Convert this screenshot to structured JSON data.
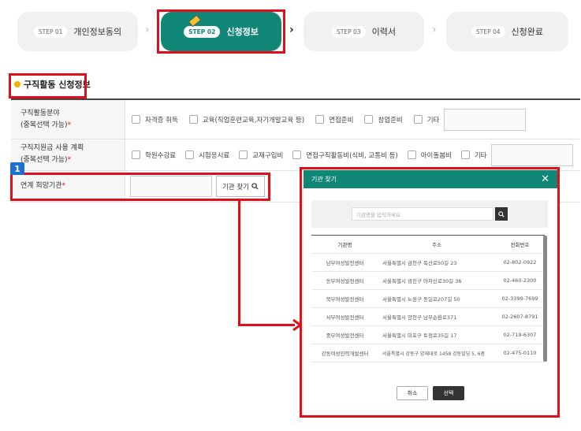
{
  "steps": [
    {
      "num": "STEP 01",
      "label": "개인정보동의"
    },
    {
      "num": "STEP 02",
      "label": "신청정보"
    },
    {
      "num": "STEP 03",
      "label": "이력서"
    },
    {
      "num": "STEP 04",
      "label": "신청완료"
    }
  ],
  "section": {
    "title": "구직활동 신청정보"
  },
  "form": {
    "row1": {
      "head_line1": "구직활동분야",
      "head_line2": "(중복선택 가능)",
      "req": "*",
      "options": [
        "자격증 취득",
        "교육(직업훈련교육,자기개발교육 등)",
        "면접준비",
        "창업준비",
        "기타"
      ]
    },
    "row2": {
      "head_line1": "구직지원금 사용 계획",
      "head_line2": "(중복선택 가능)",
      "req": "*",
      "options": [
        "학원수강료",
        "시험응시료",
        "교재구입비",
        "면접구직활동비(식비, 교통비 등)",
        "아이돌봄비",
        "기타"
      ]
    },
    "row3": {
      "head": "연계 희망기관",
      "req": "*",
      "find_button": "기관 찾기"
    }
  },
  "badge": "1",
  "modal": {
    "title": "기관 찾기",
    "close": "✕",
    "search_placeholder": "기관명을 입력하세요.",
    "columns": [
      "기관명",
      "주소",
      "전화번호"
    ],
    "rows": [
      [
        "남부여성발전센터",
        "서울특별시 금천구 독산로50길 23",
        "02-802-0922"
      ],
      [
        "동부여성발전센터",
        "서울특별시 광진구 아차산로30길 36",
        "02-460-2300"
      ],
      [
        "북부여성발전센터",
        "서울특별시 노원구 동일로207길 50",
        "02-3399-7699"
      ],
      [
        "서부여성발전센터",
        "서울특별시 양천구 남부순환로371",
        "02-2607-8791"
      ],
      [
        "중부여성발전센터",
        "서울특별시 마포구 토정로35길 17",
        "02-719-6307"
      ],
      [
        "강동여성인력개발센터",
        "서울특별시 강동구 양재대로 1458 강동빌딩 5, 6층",
        "02-475-0110"
      ]
    ],
    "cancel": "취소",
    "ok": "선택"
  },
  "colors": {
    "accent": "#118777",
    "highlight": "#e0101a",
    "badge": "#1d6fd1"
  }
}
